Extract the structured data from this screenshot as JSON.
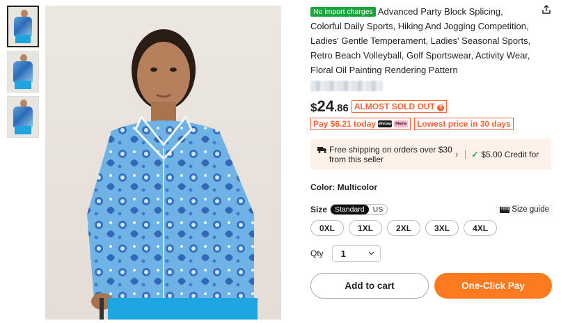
{
  "product": {
    "import_badge": "No import charges",
    "title": "Advanced Party Block Splicing, Colorful Daily Sports, Hiking And Jogging Competition, Ladies' Gentle Temperament, Ladies' Seasonal Sports, Retro Beach Volleyball, Golf Sportswear, Activity Wear, Floral Oil Painting Rendering Pattern"
  },
  "price": {
    "currency": "$",
    "integer": "24",
    "decimal": ".86",
    "stock_badge": "ALMOST SOLD OUT",
    "stock_badge_icon": "?",
    "pay_today": "Pay $6.21 today",
    "afterpay_logo": "afterpay",
    "klarna_logo": "Klarna",
    "lowest_price": "Lowest price in 30 days"
  },
  "shipping": {
    "text": "Free shipping on orders over $30 from this seller",
    "credit": "$5.00 Credit for"
  },
  "color": {
    "label": "Color: Multicolor"
  },
  "size": {
    "label": "Size",
    "modes": [
      "Standard",
      "US"
    ],
    "guide_label": "Size guide",
    "options": [
      "0XL",
      "1XL",
      "2XL",
      "3XL",
      "4XL"
    ]
  },
  "qty": {
    "label": "Qty",
    "value": "1"
  },
  "actions": {
    "add_to_cart": "Add to cart",
    "one_click": "One-Click Pay"
  },
  "colors": {
    "accent": "#fa6338",
    "buy_button": "#fd7a1f",
    "import_badge": "#1aa53c",
    "shipping_bg": "#fdf1ea"
  }
}
